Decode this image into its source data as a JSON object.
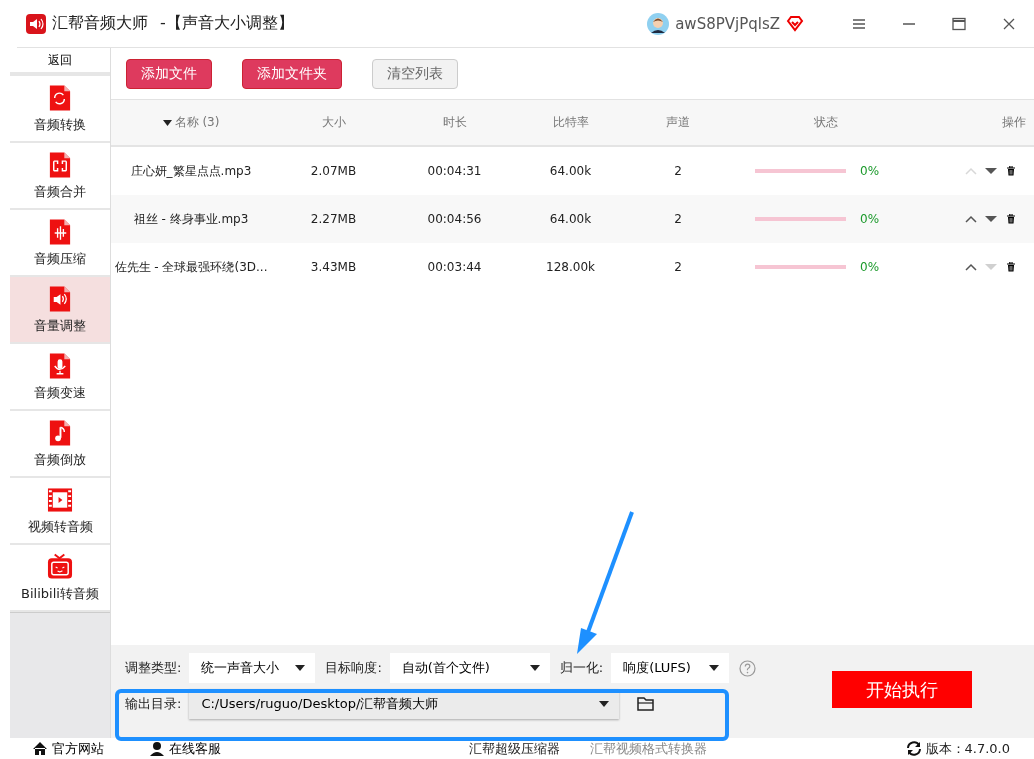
{
  "window": {
    "app_name": "汇帮音频大师",
    "title": "-【声音大小调整】",
    "user": "awS8PVjPqlsZ"
  },
  "sidebar": {
    "back": "返回",
    "items": [
      {
        "label": "音频转换",
        "selected": false
      },
      {
        "label": "音频合并",
        "selected": false
      },
      {
        "label": "音频压缩",
        "selected": false
      },
      {
        "label": "音量调整",
        "selected": true
      },
      {
        "label": "音频变速",
        "selected": false
      },
      {
        "label": "音频倒放",
        "selected": false
      },
      {
        "label": "视频转音频",
        "selected": false
      },
      {
        "label": "Bilibili转音频",
        "selected": false
      }
    ]
  },
  "toolbar": {
    "buttons": [
      {
        "label": "添加文件",
        "kind": "primary"
      },
      {
        "label": "添加文件夹",
        "kind": "primary"
      },
      {
        "label": "清空列表",
        "kind": "secondary"
      }
    ]
  },
  "table": {
    "columns": [
      "名称 (3)",
      "大小",
      "时长",
      "比特率",
      "声道",
      "状态",
      "操作"
    ],
    "rows": [
      {
        "name": "庄心妍_繁星点点.mp3",
        "size": "2.07MB",
        "duration": "00:04:31",
        "bitrate": "64.00k",
        "channels": "2",
        "level": 0,
        "percent": "0%",
        "up_disabled": true,
        "down_disabled": false
      },
      {
        "name": "祖丝 - 终身事业.mp3",
        "size": "2.27MB",
        "duration": "00:04:56",
        "bitrate": "64.00k",
        "channels": "2",
        "level": 0,
        "percent": "0%",
        "up_disabled": false,
        "down_disabled": false
      },
      {
        "name": "佐先生 - 全球最强环绕(3D...",
        "size": "3.43MB",
        "duration": "00:03:44",
        "bitrate": "128.00k",
        "channels": "2",
        "level": 0,
        "percent": "0%",
        "up_disabled": false,
        "down_disabled": true
      }
    ]
  },
  "settings": {
    "adjust_type": {
      "label": "调整类型:",
      "value": "统一声音大小"
    },
    "target": {
      "label": "目标响度:",
      "value": "自动(首个文件)"
    },
    "normalize": {
      "label": "归一化:",
      "value": "响度(LUFS)"
    },
    "output": {
      "label": "输出目录:",
      "value": "C:/Users/ruguo/Desktop/汇帮音频大师"
    },
    "start": "开始执行"
  },
  "footer": {
    "website": "官方网站",
    "support": "在线客服",
    "links": [
      "汇帮超级压缩器",
      "汇帮视频格式转换器"
    ],
    "version": "版本：4.7.0.0"
  }
}
